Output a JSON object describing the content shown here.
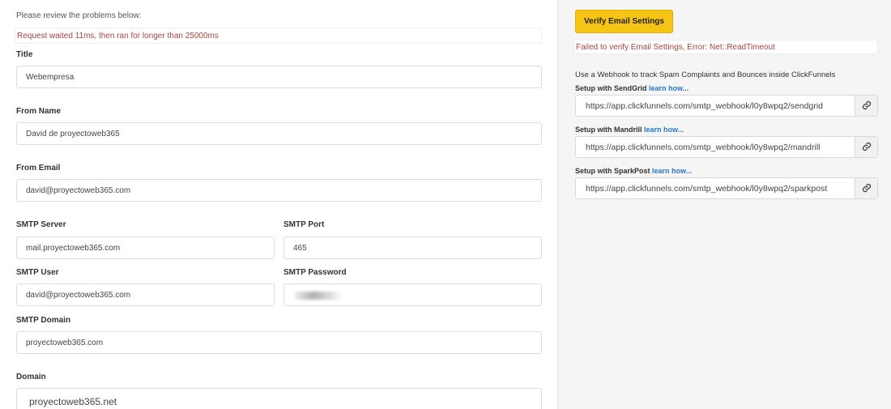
{
  "errors": {
    "heading": "Please review the problems below:",
    "message": "Request waited 11ms, then ran for longer than 25000ms"
  },
  "form": {
    "title_label": "Title",
    "title_value": "Webempresa",
    "from_name_label": "From Name",
    "from_name_value": "David de proyectoweb365",
    "from_email_label": "From Email",
    "from_email_value": "david@proyectoweb365.com",
    "smtp_server_label": "SMTP Server",
    "smtp_server_value": "mail.proyectoweb365.com",
    "smtp_port_label": "SMTP Port",
    "smtp_port_value": "465",
    "smtp_user_label": "SMTP User",
    "smtp_user_value": "david@proyectoweb365.com",
    "smtp_password_label": "SMTP Password",
    "smtp_domain_label": "SMTP Domain",
    "smtp_domain_value": "proyectoweb365.com",
    "domain_label": "Domain",
    "domain_value": "proyectoweb365.net"
  },
  "verify": {
    "button_label": "Verify Email Settings",
    "error_message": "Failed to verify Email Settings, Error: Net::ReadTimeout"
  },
  "webhooks": {
    "intro": "Use a Webhook to track Spam Complaints and Bounces inside ClickFunnels",
    "learn_label": "learn how...",
    "items": [
      {
        "label": "Setup with SendGrid",
        "url": "https://app.clickfunnels.com/smtp_webhook/l0y8wpq2/sendgrid"
      },
      {
        "label": "Setup with Mandrill",
        "url": "https://app.clickfunnels.com/smtp_webhook/l0y8wpq2/mandrill"
      },
      {
        "label": "Setup with SparkPost",
        "url": "https://app.clickfunnels.com/smtp_webhook/l0y8wpq2/sparkpost"
      }
    ]
  },
  "icons": {
    "copy": "link-icon"
  },
  "colors": {
    "accent_button": "#f6c414",
    "error_text": "#a94442",
    "link": "#2a77c9",
    "sidebar_bg": "#f5f5f6"
  }
}
